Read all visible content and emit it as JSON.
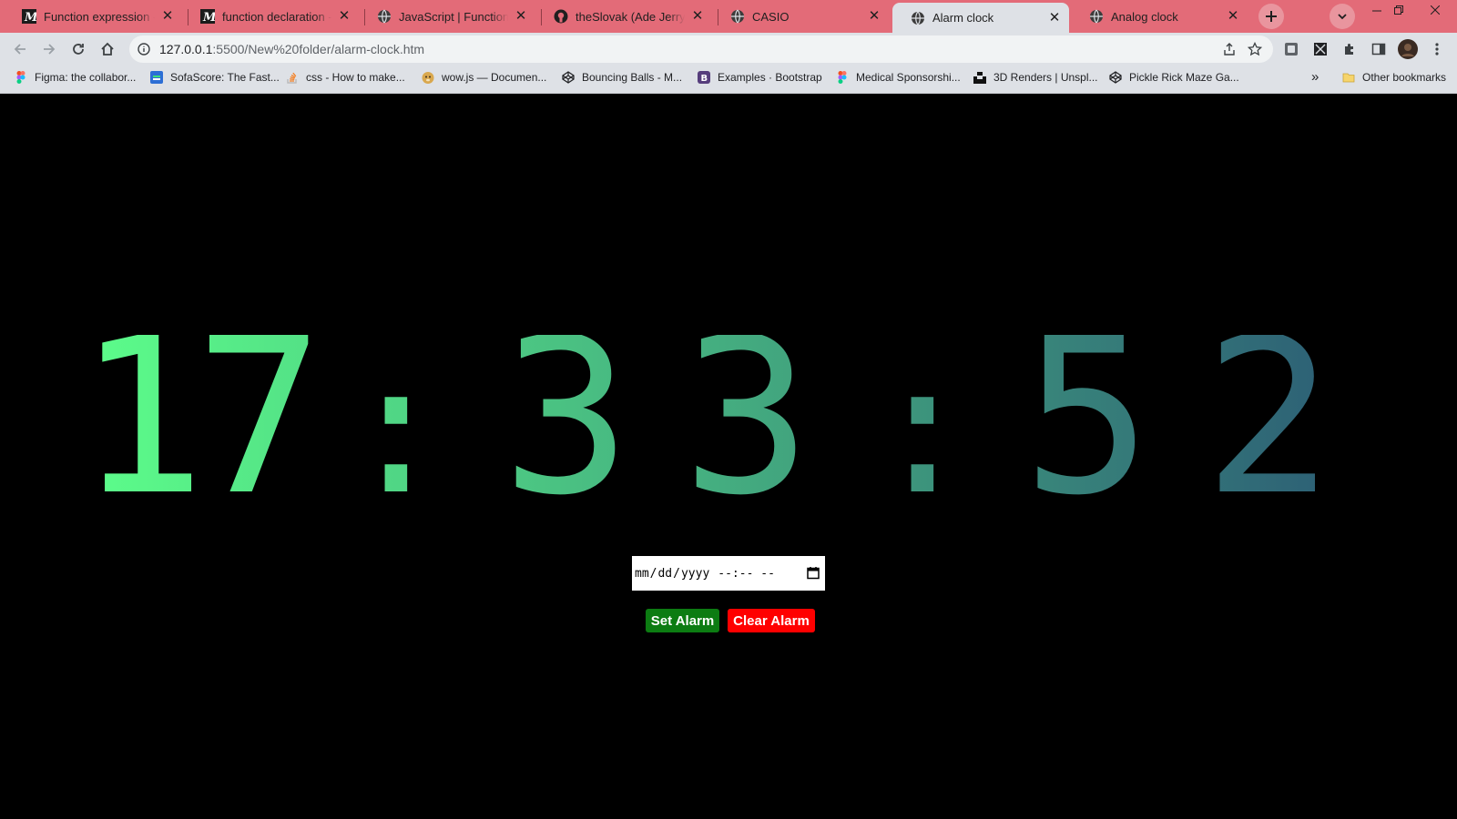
{
  "browser": {
    "tabs": [
      {
        "title": "Function expression - JavaScript | MDN",
        "icon": "mdn-icon",
        "active": false
      },
      {
        "title": "function declaration - JavaScript | MDN",
        "icon": "mdn-icon",
        "active": false
      },
      {
        "title": "JavaScript | Function expressions",
        "icon": "globe-icon",
        "active": false
      },
      {
        "title": "theSlovak (Ade Jerry)",
        "icon": "github-icon",
        "active": false
      },
      {
        "title": "CASIO",
        "icon": "globe-icon",
        "active": false
      },
      {
        "title": "Alarm clock",
        "icon": "globe-icon",
        "active": true
      },
      {
        "title": "Analog clock",
        "icon": "globe-icon",
        "active": false
      }
    ],
    "url_host": "127.0.0.1",
    "url_path": ":5500/New%20folder/alarm-clock.htm",
    "bookmarks": [
      {
        "label": "Figma: the collabor...",
        "icon": "figma-icon"
      },
      {
        "label": "SofaScore: The Fast...",
        "icon": "sofascore-icon"
      },
      {
        "label": "css - How to make...",
        "icon": "stackoverflow-icon"
      },
      {
        "label": "wow.js — Documen...",
        "icon": "doge-icon"
      },
      {
        "label": "Bouncing Balls - M...",
        "icon": "codepen-icon"
      },
      {
        "label": "Examples · Bootstrap",
        "icon": "bootstrap-icon"
      },
      {
        "label": "Medical Sponsorshi...",
        "icon": "figma-icon"
      },
      {
        "label": "3D Renders | Unspl...",
        "icon": "unsplash-icon"
      },
      {
        "label": "Pickle Rick Maze Ga...",
        "icon": "codepen-icon"
      }
    ],
    "bookmarks_overflow": "»",
    "other_bookmarks": "Other bookmarks",
    "accent_tabstrip": "#e36b78"
  },
  "clock": {
    "hours": "17",
    "minutes": "33",
    "seconds": "52",
    "separator": ":",
    "gradient_start": "#5cfd8a",
    "gradient_end": "#2c5c75"
  },
  "alarm": {
    "input_mm": "mm",
    "input_dd": "dd",
    "input_yyyy": "yyyy",
    "input_time": "--:-- --",
    "set_label": "Set Alarm",
    "clear_label": "Clear Alarm",
    "set_color": "#0c7c12",
    "clear_color": "#ff0000"
  }
}
